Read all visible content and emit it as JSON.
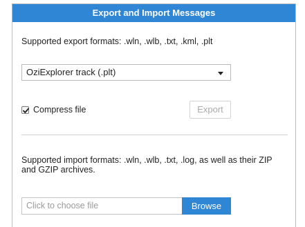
{
  "header": {
    "title": "Export and Import Messages"
  },
  "export": {
    "formats_text": "Supported export formats: .wln, .wlb, .txt, .kml, .plt",
    "selected_format": "OziExplorer track (.plt)",
    "compress_label": "Compress file",
    "compress_checked": true,
    "export_button_label": "Export",
    "export_button_enabled": false
  },
  "import": {
    "formats_text": "Supported import formats: .wln, .wlb, .txt, .log, as well as their ZIP and GZIP archives.",
    "file_placeholder": "Click to choose file",
    "browse_button_label": "Browse"
  },
  "icons": {
    "select_caret": "chevron-down-icon",
    "checkbox_mark": "checkmark-icon"
  },
  "colors": {
    "accent": "#2f86d4",
    "disabled_text": "#a9a9a9",
    "placeholder_text": "#9a9a9a"
  }
}
